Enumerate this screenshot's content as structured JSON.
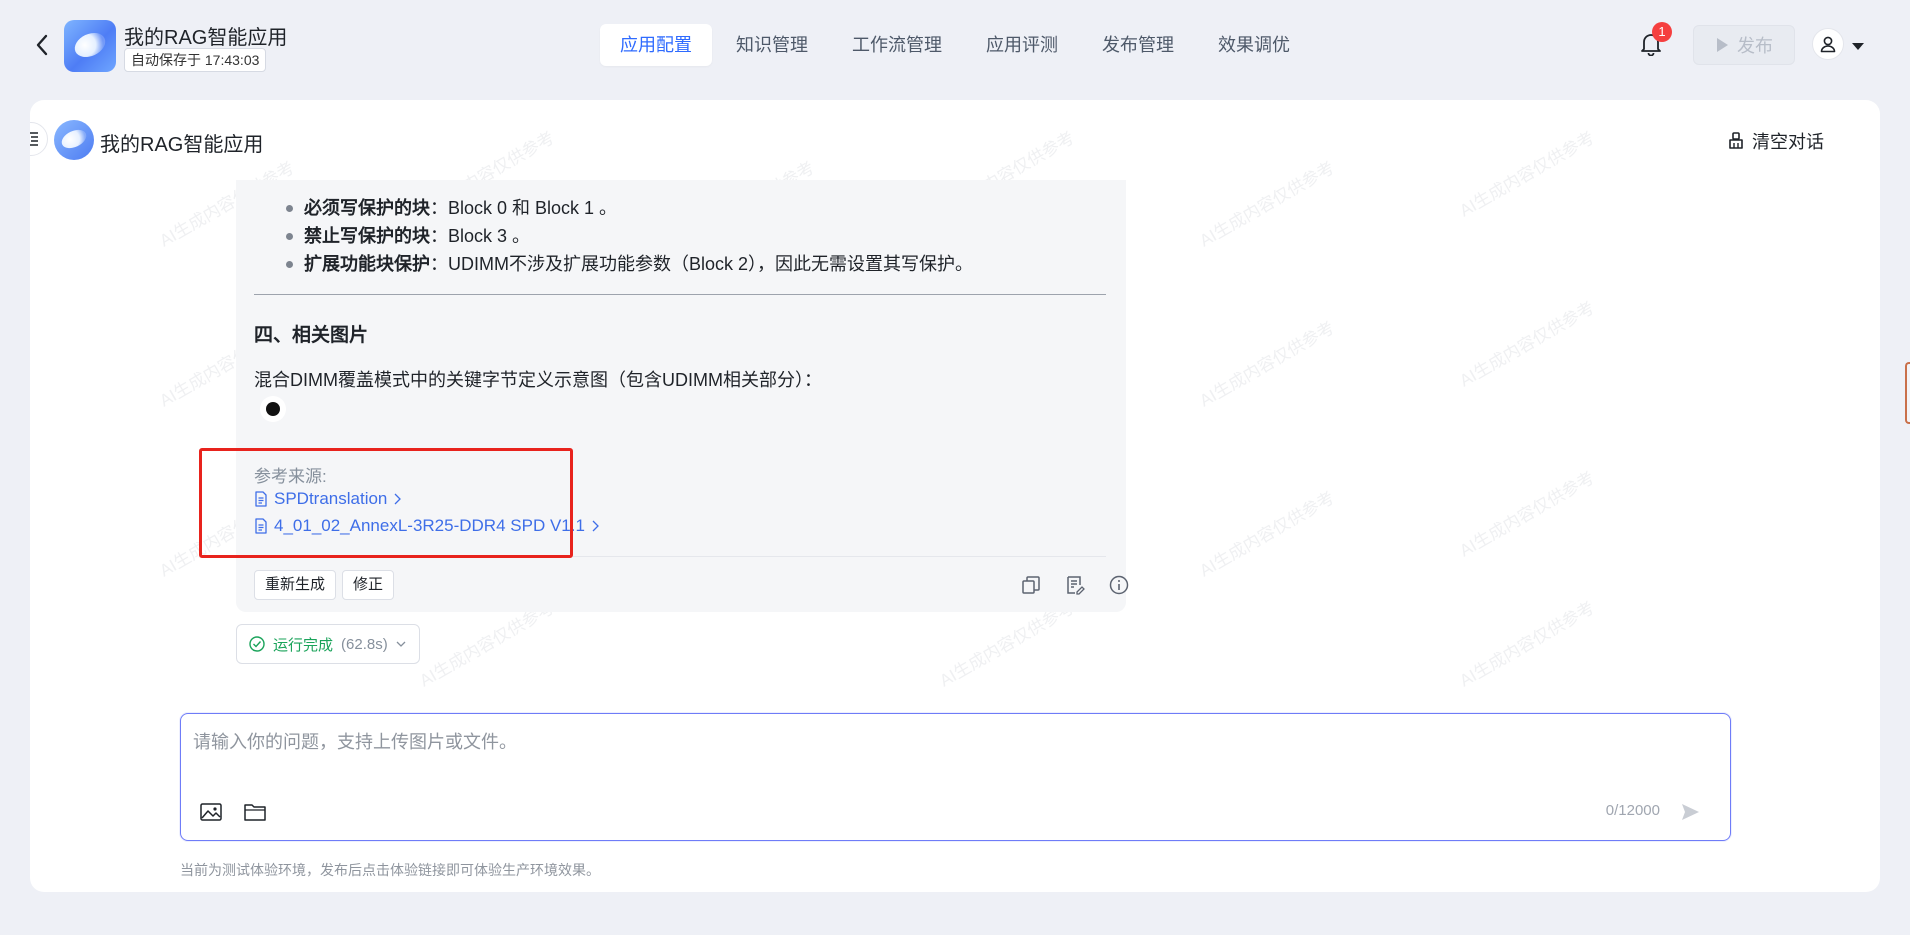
{
  "header": {
    "app_name": "我的RAG智能应用",
    "autosave": "自动保存于 17:43:03",
    "nav_tabs": [
      "应用配置",
      "知识管理",
      "工作流管理",
      "应用评测",
      "发布管理",
      "效果调优"
    ],
    "active_tab": "应用配置",
    "notification_count": "1",
    "publish_label": "发布"
  },
  "chat": {
    "title": "我的RAG智能应用",
    "clear_label": "清空对话",
    "message": {
      "bullets": [
        {
          "bold": "必须写保护的块",
          "text": "：Block 0 和 Block 1 。"
        },
        {
          "bold": "禁止写保护的块",
          "text": "：Block 3 。"
        },
        {
          "bold": "扩展功能块保护",
          "text": "：UDIMM不涉及扩展功能参数（Block 2），因此无需设置其写保护。"
        }
      ],
      "section_title": "四、相关图片",
      "image_caption": "混合DIMM覆盖模式中的关键字节定义示意图（包含UDIMM相关部分）：",
      "refs_label": "参考来源:",
      "refs": [
        "SPDtranslation",
        "4_01_02_AnnexL-3R25-DDR4 SPD V1.1"
      ],
      "regenerate_label": "重新生成",
      "fix_label": "修正"
    },
    "run_status": {
      "label": "运行完成",
      "duration": "(62.8s)"
    }
  },
  "input": {
    "placeholder": "请输入你的问题，支持上传图片或文件。",
    "counter": "0/12000"
  },
  "footer_note": "当前为测试体验环境，发布后点击体验链接即可体验生产环境效果。",
  "watermark": "AI生成内容仅供参考",
  "colors": {
    "accent": "#2f6bff",
    "link": "#3e6ee8",
    "success": "#1aa35a",
    "highlight": "#e8231d",
    "badge": "#f53f3f"
  }
}
